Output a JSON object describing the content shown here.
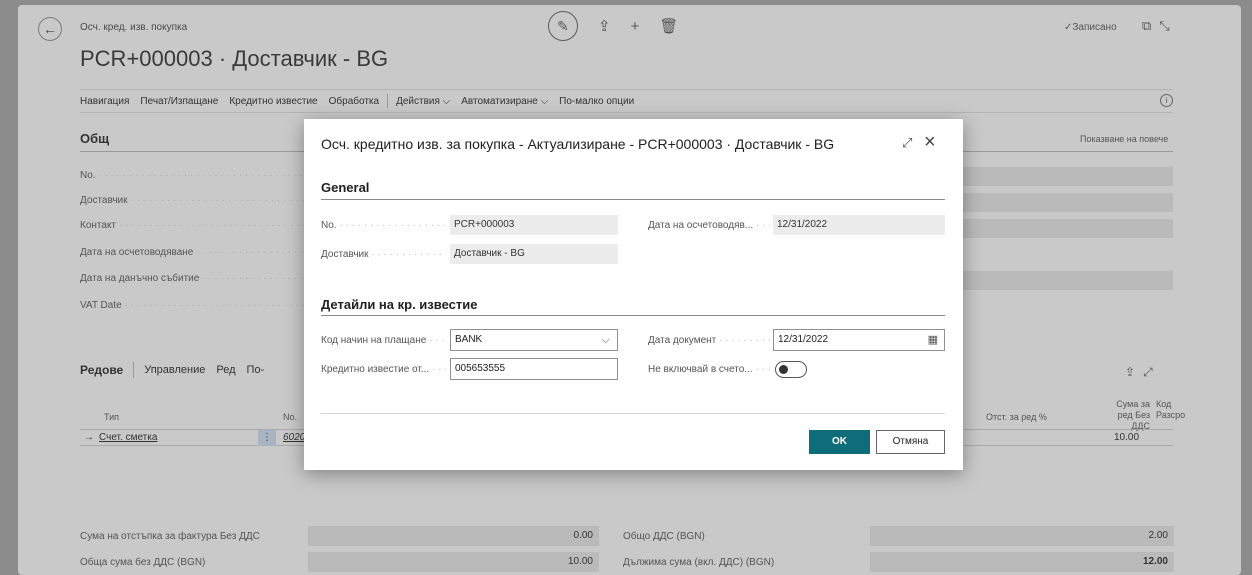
{
  "page": {
    "subtitle": "Осч. кред. изв. покупка",
    "title": "PCR+000003 · Доставчик - BG",
    "saved_status": "✓Записано",
    "nav": [
      "Навигация",
      "Печат/Изпащане",
      "Кредитно известие",
      "Обработка",
      "Действия ⌵",
      "Автоматизиране ⌵",
      "По-малко опции"
    ],
    "general_title": "Общ",
    "show_more": "Показване на повече",
    "general_fields": [
      "No.",
      "Доставчик",
      "Контакт",
      "Дата на осчетоводяване",
      "Дата на данъчно събитие",
      "VAT Date"
    ],
    "lines": {
      "title": "Редове",
      "actions": [
        "Управление",
        "Ред",
        "По-"
      ],
      "col_type": "Тип",
      "col_no": "No.",
      "col_discount": "Отст. за ред %",
      "col_amount": "Сума за ред Без ДДС",
      "col_code": "Код Разсро",
      "row_type": "Счет. сметка",
      "row_no": "6020",
      "row_amount": "10.00"
    },
    "totals": {
      "discount_label": "Сума на отстъпка за фактура Без ДДС",
      "discount_value": "0.00",
      "net_label": "Обща сума без ДДС (BGN)",
      "net_value": "10.00",
      "vat_label": "Общо ДДС (BGN)",
      "vat_value": "2.00",
      "due_label": "Дължима сума (вкл. ДДС) (BGN)",
      "due_value": "12.00"
    }
  },
  "modal": {
    "title": "Осч. кредитно изв. за покупка - Актуализиране - PCR+000003 · Доставчик - BG",
    "general_section": "General",
    "no_label": "No.",
    "no_value": "PCR+000003",
    "vendor_label": "Доставчик",
    "vendor_value": "Доставчик - BG",
    "posting_date_label": "Дата на осчетоводяв...",
    "posting_date_value": "12/31/2022",
    "details_section": "Детайли на кр. известие",
    "payment_method_label": "Код начин на плащане",
    "payment_method_value": "BANK",
    "doc_date_label": "Дата документ",
    "doc_date_value": "12/31/2022",
    "credit_memo_label": "Кредитно известие от...",
    "credit_memo_value": "005653555",
    "exclude_label": "Не включвай в счето...",
    "ok_label": "OK",
    "cancel_label": "Отмяна"
  }
}
